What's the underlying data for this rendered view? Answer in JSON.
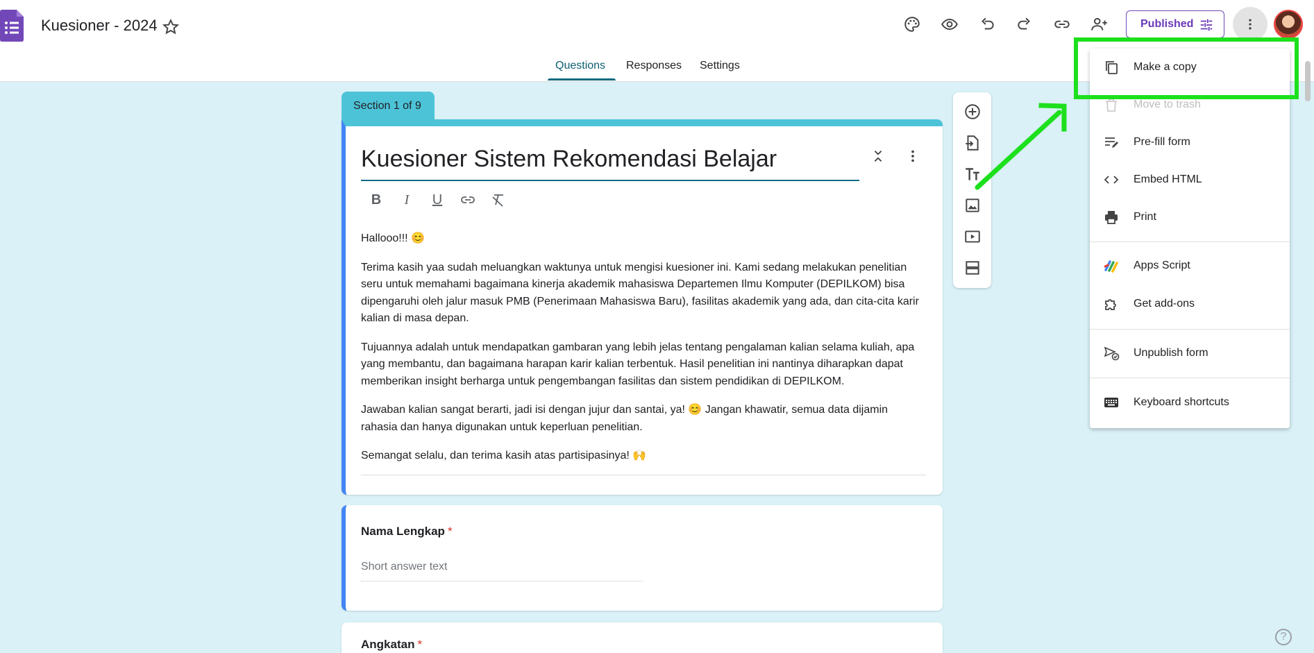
{
  "header": {
    "doc_title": "Kuesioner - 2024",
    "publish_label": "Published",
    "icons": [
      "palette-icon",
      "preview-eye-icon",
      "undo-icon",
      "redo-icon",
      "link-icon",
      "add-collaborator-icon",
      "customize-icon",
      "more-vert-icon"
    ]
  },
  "tabs": [
    "Questions",
    "Responses",
    "Settings"
  ],
  "section": {
    "label": "Section 1 of 9",
    "title": "Kuesioner Sistem Rekomendasi Belajar",
    "paragraphs": [
      "Hallooo!!! 😊",
      "Terima kasih yaa sudah meluangkan waktunya untuk mengisi kuesioner ini. Kami sedang melakukan penelitian seru untuk memahami bagaimana kinerja akademik mahasiswa Departemen Ilmu Komputer (DEPILKOM) bisa dipengaruhi oleh jalur masuk PMB (Penerimaan Mahasiswa Baru), fasilitas akademik yang ada, dan cita-cita karir kalian di masa depan.",
      "Tujuannya adalah untuk mendapatkan gambaran yang lebih jelas tentang pengalaman kalian selama kuliah, apa yang membantu, dan bagaimana harapan karir kalian terbentuk. Hasil penelitian ini nantinya diharapkan dapat memberikan insight berharga untuk pengembangan fasilitas dan sistem pendidikan di DEPILKOM.",
      "Jawaban kalian sangat berarti, jadi isi dengan jujur dan santai, ya! 😊 Jangan khawatir, semua data dijamin rahasia dan hanya digunakan untuk keperluan penelitian.",
      "Semangat selalu, dan terima kasih atas partisipasinya! 🙌"
    ]
  },
  "questions": [
    {
      "title": "Nama Lengkap",
      "required_mark": "*",
      "placeholder": "Short answer text"
    },
    {
      "title": "Angkatan",
      "required_mark": "*"
    }
  ],
  "menu": {
    "items": [
      {
        "label": "Make a copy",
        "icon": "copy-icon",
        "disabled": false
      },
      {
        "label": "Move to trash",
        "icon": "trash-icon",
        "disabled": true
      },
      {
        "label": "Pre-fill form",
        "icon": "prefill-icon",
        "disabled": false
      },
      {
        "label": "Embed HTML",
        "icon": "code-icon",
        "disabled": false
      },
      {
        "label": "Print",
        "icon": "print-icon",
        "disabled": false
      },
      {
        "label": "Apps Script",
        "icon": "apps-script-icon",
        "disabled": false
      },
      {
        "label": "Get add-ons",
        "icon": "puzzle-icon",
        "disabled": false
      },
      {
        "label": "Unpublish form",
        "icon": "unpublish-icon",
        "disabled": false
      },
      {
        "label": "Keyboard shortcuts",
        "icon": "keyboard-icon",
        "disabled": false
      }
    ]
  },
  "help": "?",
  "colors": {
    "accent": "#4dc3d8",
    "purple": "#6a39b8",
    "highlight": "#1de01d",
    "background": "#d9f1f7"
  }
}
